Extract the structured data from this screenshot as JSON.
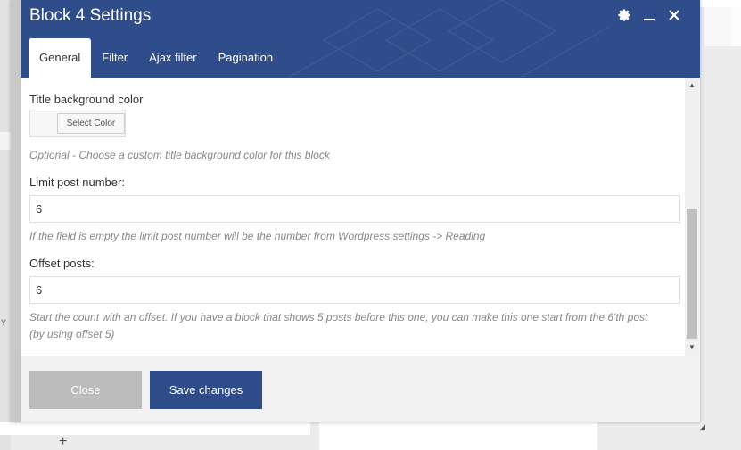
{
  "modal": {
    "title": "Block 4 Settings",
    "tabs": [
      {
        "label": "General",
        "active": true
      },
      {
        "label": "Filter",
        "active": false
      },
      {
        "label": "Ajax filter",
        "active": false
      },
      {
        "label": "Pagination",
        "active": false
      }
    ]
  },
  "icons": {
    "settings": "gear-icon",
    "minimize": "minimize-icon",
    "close": "close-icon"
  },
  "fields": {
    "title_bg_color": {
      "label": "Title background color",
      "button_label": "Select Color",
      "description": "Optional - Choose a custom title background color for this block"
    },
    "limit_post_number": {
      "label": "Limit post number:",
      "value": "6",
      "description": "If the field is empty the limit post number will be the number from Wordpress settings -> Reading"
    },
    "offset_posts": {
      "label": "Offset posts:",
      "value": "6",
      "description": "Start the count with an offset. If you have a block that shows 5 posts before this one, you can make this one start from the 6'th post (by using offset 5)"
    }
  },
  "footer": {
    "close_label": "Close",
    "save_label": "Save changes"
  },
  "background": {
    "left_fragment": "Y",
    "plus": "+"
  },
  "colors": {
    "header": "#2f4d8a",
    "save_button": "#2f4d8a",
    "close_button": "#bcbcbc"
  }
}
